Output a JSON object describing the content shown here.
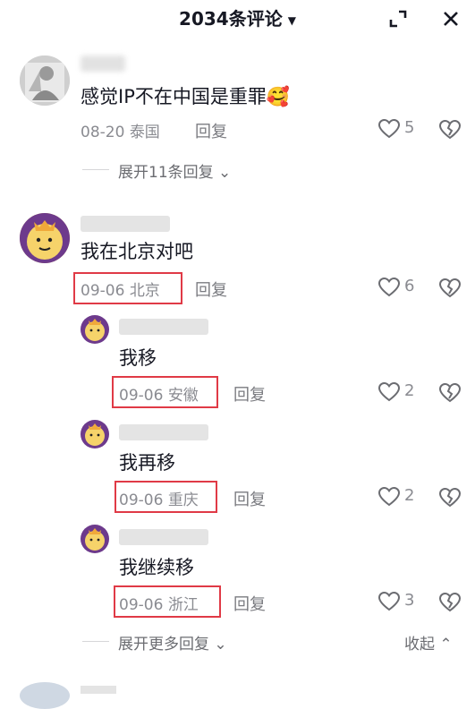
{
  "header": {
    "title": "2034条评论",
    "expand_icon": "expand-icon",
    "close_icon": "close-icon"
  },
  "colors": {
    "highlight": "#e03a46",
    "text": "#161823",
    "meta": "#8a8b91"
  },
  "comments": [
    {
      "text": "感觉IP不在中国是重罪",
      "emoji": "🥰",
      "date": "08-20",
      "location": "泰国",
      "reply_label": "回复",
      "likes": "5",
      "expand_label": "展开11条回复"
    },
    {
      "text": "我在北京对吧",
      "date": "09-06",
      "location": "北京",
      "reply_label": "回复",
      "likes": "6",
      "replies": [
        {
          "text": "我移",
          "date": "09-06",
          "location": "安徽",
          "reply_label": "回复",
          "likes": "2"
        },
        {
          "text": "我再移",
          "date": "09-06",
          "location": "重庆",
          "reply_label": "回复",
          "likes": "2"
        },
        {
          "text": "我继续移",
          "date": "09-06",
          "location": "浙江",
          "reply_label": "回复",
          "likes": "3"
        }
      ],
      "expand_more_label": "展开更多回复",
      "collapse_label": "收起"
    }
  ]
}
